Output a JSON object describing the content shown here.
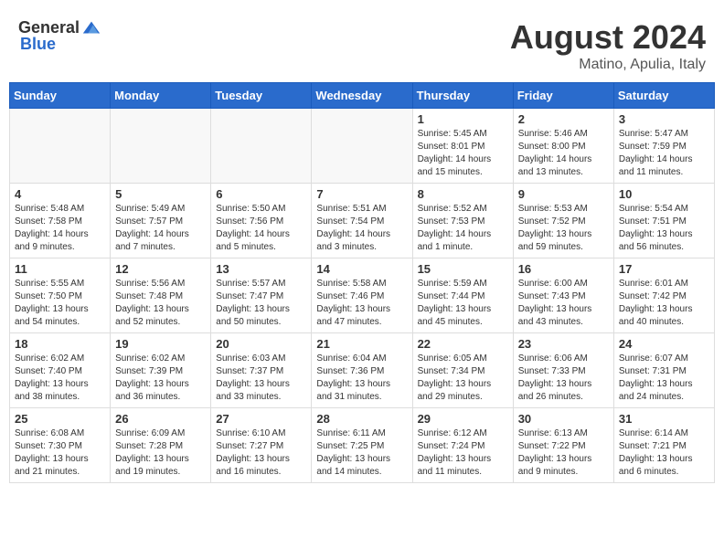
{
  "header": {
    "logo_general": "General",
    "logo_blue": "Blue",
    "month_year": "August 2024",
    "location": "Matino, Apulia, Italy"
  },
  "weekdays": [
    "Sunday",
    "Monday",
    "Tuesday",
    "Wednesday",
    "Thursday",
    "Friday",
    "Saturday"
  ],
  "weeks": [
    [
      {
        "day": "",
        "info": ""
      },
      {
        "day": "",
        "info": ""
      },
      {
        "day": "",
        "info": ""
      },
      {
        "day": "",
        "info": ""
      },
      {
        "day": "1",
        "info": "Sunrise: 5:45 AM\nSunset: 8:01 PM\nDaylight: 14 hours\nand 15 minutes."
      },
      {
        "day": "2",
        "info": "Sunrise: 5:46 AM\nSunset: 8:00 PM\nDaylight: 14 hours\nand 13 minutes."
      },
      {
        "day": "3",
        "info": "Sunrise: 5:47 AM\nSunset: 7:59 PM\nDaylight: 14 hours\nand 11 minutes."
      }
    ],
    [
      {
        "day": "4",
        "info": "Sunrise: 5:48 AM\nSunset: 7:58 PM\nDaylight: 14 hours\nand 9 minutes."
      },
      {
        "day": "5",
        "info": "Sunrise: 5:49 AM\nSunset: 7:57 PM\nDaylight: 14 hours\nand 7 minutes."
      },
      {
        "day": "6",
        "info": "Sunrise: 5:50 AM\nSunset: 7:56 PM\nDaylight: 14 hours\nand 5 minutes."
      },
      {
        "day": "7",
        "info": "Sunrise: 5:51 AM\nSunset: 7:54 PM\nDaylight: 14 hours\nand 3 minutes."
      },
      {
        "day": "8",
        "info": "Sunrise: 5:52 AM\nSunset: 7:53 PM\nDaylight: 14 hours\nand 1 minute."
      },
      {
        "day": "9",
        "info": "Sunrise: 5:53 AM\nSunset: 7:52 PM\nDaylight: 13 hours\nand 59 minutes."
      },
      {
        "day": "10",
        "info": "Sunrise: 5:54 AM\nSunset: 7:51 PM\nDaylight: 13 hours\nand 56 minutes."
      }
    ],
    [
      {
        "day": "11",
        "info": "Sunrise: 5:55 AM\nSunset: 7:50 PM\nDaylight: 13 hours\nand 54 minutes."
      },
      {
        "day": "12",
        "info": "Sunrise: 5:56 AM\nSunset: 7:48 PM\nDaylight: 13 hours\nand 52 minutes."
      },
      {
        "day": "13",
        "info": "Sunrise: 5:57 AM\nSunset: 7:47 PM\nDaylight: 13 hours\nand 50 minutes."
      },
      {
        "day": "14",
        "info": "Sunrise: 5:58 AM\nSunset: 7:46 PM\nDaylight: 13 hours\nand 47 minutes."
      },
      {
        "day": "15",
        "info": "Sunrise: 5:59 AM\nSunset: 7:44 PM\nDaylight: 13 hours\nand 45 minutes."
      },
      {
        "day": "16",
        "info": "Sunrise: 6:00 AM\nSunset: 7:43 PM\nDaylight: 13 hours\nand 43 minutes."
      },
      {
        "day": "17",
        "info": "Sunrise: 6:01 AM\nSunset: 7:42 PM\nDaylight: 13 hours\nand 40 minutes."
      }
    ],
    [
      {
        "day": "18",
        "info": "Sunrise: 6:02 AM\nSunset: 7:40 PM\nDaylight: 13 hours\nand 38 minutes."
      },
      {
        "day": "19",
        "info": "Sunrise: 6:02 AM\nSunset: 7:39 PM\nDaylight: 13 hours\nand 36 minutes."
      },
      {
        "day": "20",
        "info": "Sunrise: 6:03 AM\nSunset: 7:37 PM\nDaylight: 13 hours\nand 33 minutes."
      },
      {
        "day": "21",
        "info": "Sunrise: 6:04 AM\nSunset: 7:36 PM\nDaylight: 13 hours\nand 31 minutes."
      },
      {
        "day": "22",
        "info": "Sunrise: 6:05 AM\nSunset: 7:34 PM\nDaylight: 13 hours\nand 29 minutes."
      },
      {
        "day": "23",
        "info": "Sunrise: 6:06 AM\nSunset: 7:33 PM\nDaylight: 13 hours\nand 26 minutes."
      },
      {
        "day": "24",
        "info": "Sunrise: 6:07 AM\nSunset: 7:31 PM\nDaylight: 13 hours\nand 24 minutes."
      }
    ],
    [
      {
        "day": "25",
        "info": "Sunrise: 6:08 AM\nSunset: 7:30 PM\nDaylight: 13 hours\nand 21 minutes."
      },
      {
        "day": "26",
        "info": "Sunrise: 6:09 AM\nSunset: 7:28 PM\nDaylight: 13 hours\nand 19 minutes."
      },
      {
        "day": "27",
        "info": "Sunrise: 6:10 AM\nSunset: 7:27 PM\nDaylight: 13 hours\nand 16 minutes."
      },
      {
        "day": "28",
        "info": "Sunrise: 6:11 AM\nSunset: 7:25 PM\nDaylight: 13 hours\nand 14 minutes."
      },
      {
        "day": "29",
        "info": "Sunrise: 6:12 AM\nSunset: 7:24 PM\nDaylight: 13 hours\nand 11 minutes."
      },
      {
        "day": "30",
        "info": "Sunrise: 6:13 AM\nSunset: 7:22 PM\nDaylight: 13 hours\nand 9 minutes."
      },
      {
        "day": "31",
        "info": "Sunrise: 6:14 AM\nSunset: 7:21 PM\nDaylight: 13 hours\nand 6 minutes."
      }
    ]
  ]
}
